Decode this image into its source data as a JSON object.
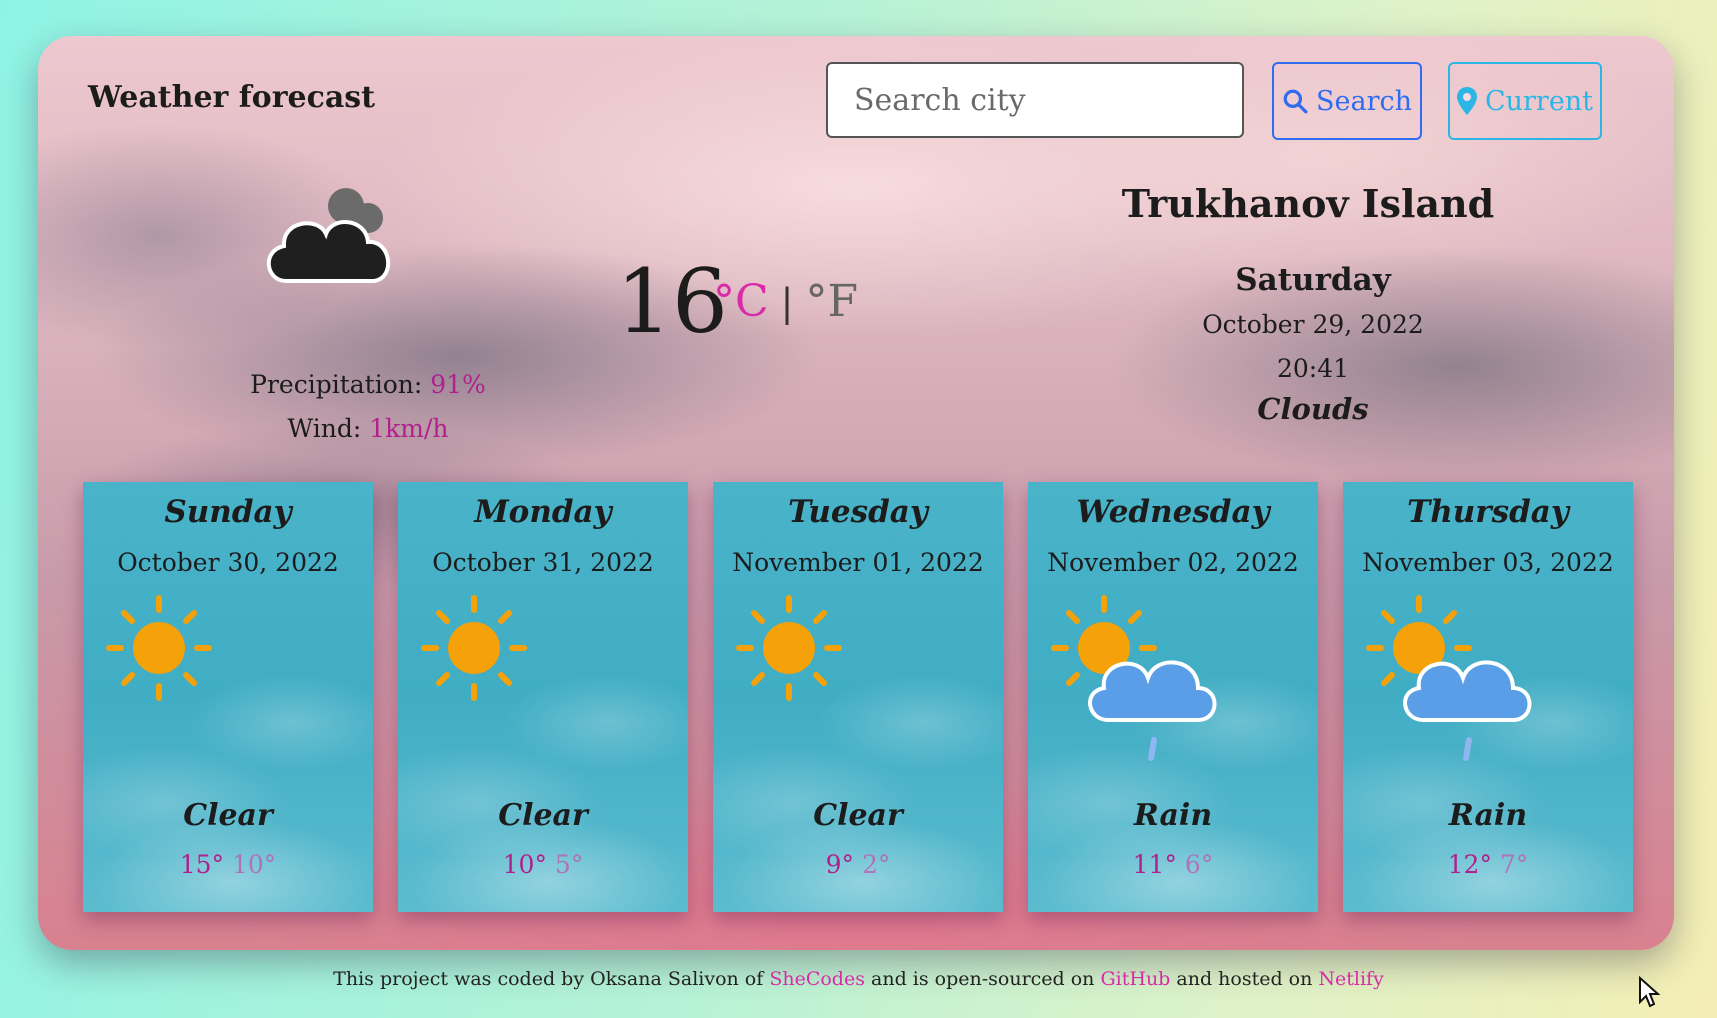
{
  "header": {
    "title": "Weather forecast"
  },
  "search": {
    "placeholder": "Search city",
    "value": "",
    "button_label": "Search",
    "current_label": "Current"
  },
  "current": {
    "city": "Trukhanov Island",
    "day": "Saturday",
    "date": "October 29, 2022",
    "time": "20:41",
    "description": "Clouds",
    "temperature": "16",
    "unit_c": "°C",
    "unit_sep": "|",
    "unit_f": "°F",
    "precipitation_label": "Precipitation:",
    "precipitation_value": "91%",
    "wind_label": "Wind:",
    "wind_value": "1km/h",
    "icon": "cloud-icon"
  },
  "forecast": [
    {
      "day": "Sunday",
      "date": "October 30, 2022",
      "icon": "sun-icon",
      "description": "Clear",
      "max": "15°",
      "min": "10°"
    },
    {
      "day": "Monday",
      "date": "October 31, 2022",
      "icon": "sun-icon",
      "description": "Clear",
      "max": "10°",
      "min": "5°"
    },
    {
      "day": "Tuesday",
      "date": "November 01, 2022",
      "icon": "sun-icon",
      "description": "Clear",
      "max": "9°",
      "min": "2°"
    },
    {
      "day": "Wednesday",
      "date": "November 02, 2022",
      "icon": "sun-rain-icon",
      "description": "Rain",
      "max": "11°",
      "min": "6°"
    },
    {
      "day": "Thursday",
      "date": "November 03, 2022",
      "icon": "sun-rain-icon",
      "description": "Rain",
      "max": "12°",
      "min": "7°"
    }
  ],
  "footer": {
    "text1": "This project was coded by Oksana Salivon of",
    "link1": "SheCodes",
    "text2": "and is open-sourced on",
    "link2": "GitHub",
    "text3": "and hosted on",
    "link3": "Netlify"
  },
  "colors": {
    "accent": "#d92aa8",
    "search_button": "#2f6cf0",
    "current_button": "#2cb6e5",
    "card": "#45b0c6"
  }
}
